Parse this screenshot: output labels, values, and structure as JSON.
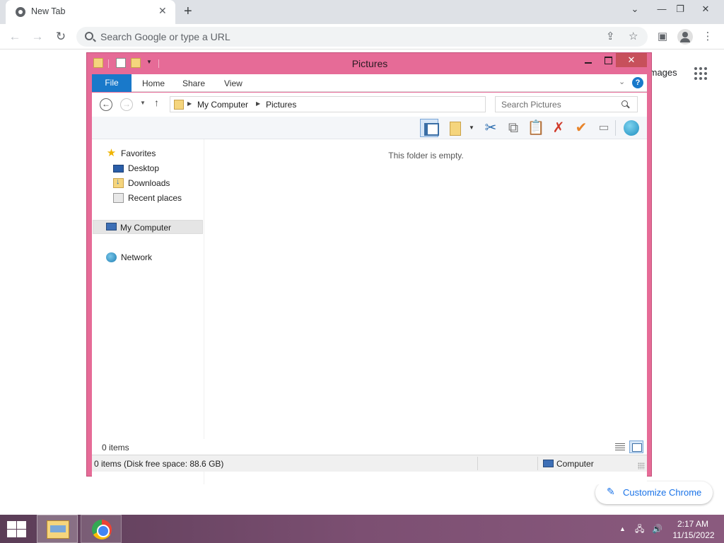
{
  "browser": {
    "tab_title": "New Tab",
    "omnibox_placeholder": "Search Google or type a URL",
    "images_link": "Images",
    "customize_label": "Customize Chrome"
  },
  "explorer": {
    "title": "Pictures",
    "ribbon": {
      "file": "File",
      "home": "Home",
      "share": "Share",
      "view": "View"
    },
    "address": {
      "crumbs": [
        "My Computer",
        "Pictures"
      ]
    },
    "search_placeholder": "Search Pictures",
    "nav": {
      "favorites": "Favorites",
      "desktop": "Desktop",
      "downloads": "Downloads",
      "recent": "Recent places",
      "computer": "My Computer",
      "network": "Network"
    },
    "empty_message": "This folder is empty.",
    "items_count": "0 items",
    "status_text": "0 items (Disk free space: 88.6 GB)",
    "status_location": "Computer"
  },
  "taskbar": {
    "time": "2:17 AM",
    "date": "11/15/2022"
  },
  "colors": {
    "window_frame": "#e66b97",
    "file_tab": "#1979ca",
    "close_button": "#c7505b",
    "taskbar": "#7c4f72",
    "chrome_accent": "#1a73e8"
  }
}
